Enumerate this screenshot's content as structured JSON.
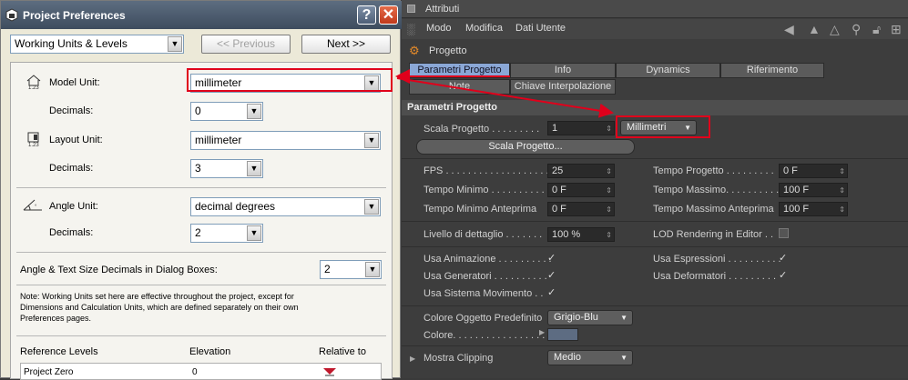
{
  "left": {
    "title": "Project Preferences",
    "help_glyph": "?",
    "close_glyph": "✕",
    "category": "Working Units & Levels",
    "prev_label": "<< Previous",
    "next_label": "Next >>",
    "model_unit_label": "Model Unit:",
    "model_unit_value": "millimeter",
    "model_decimals_label": "Decimals:",
    "model_decimals_value": "0",
    "layout_unit_label": "Layout Unit:",
    "layout_unit_value": "millimeter",
    "layout_decimals_label": "Decimals:",
    "layout_decimals_value": "3",
    "angle_unit_label": "Angle Unit:",
    "angle_unit_value": "decimal degrees",
    "angle_decimals_label": "Decimals:",
    "angle_decimals_value": "2",
    "dialog_decimals_label": "Angle & Text Size Decimals in Dialog Boxes:",
    "dialog_decimals_value": "2",
    "note_line1": "Note: Working Units set here are effective throughout the project, except for",
    "note_line2": "Dimensions and Calculation Units, which are defined separately on their own",
    "note_line3": "Preferences pages.",
    "ref_col1": "Reference Levels",
    "ref_col2": "Elevation",
    "ref_col3": "Relative to",
    "ref_row_name": "Project Zero",
    "ref_row_elev": "0"
  },
  "right": {
    "title": "Attributi",
    "menu": [
      "Modo",
      "Modifica",
      "Dati Utente"
    ],
    "object_name": "Progetto",
    "tabs_row1": [
      "Parametri Progetto",
      "Info",
      "Dynamics",
      "Riferimento"
    ],
    "tabs_row2": [
      "Note",
      "Chiave Interpolazione"
    ],
    "section": "Parametri Progetto",
    "scala_label": "Scala Progetto . . . . . . . . .",
    "scala_value": "1",
    "scala_unit": "Millimetri",
    "scala_button": "Scala Progetto...",
    "fps_label": "FPS . . . . . . . . . . . . . . . . . . . .",
    "fps_value": "25",
    "tempo_progetto_label": "Tempo Progetto . . . . . . . . .",
    "tempo_progetto_value": "0 F",
    "tempo_minimo_label": "Tempo Minimo . . . . . . . . . . .",
    "tempo_minimo_value": "0 F",
    "tempo_massimo_label": "Tempo Massimo. . . . . . . . . .",
    "tempo_massimo_value": "100 F",
    "tmin_anteprima_label": "Tempo Minimo Anteprima",
    "tmin_anteprima_value": "0 F",
    "tmax_anteprima_label": "Tempo Massimo Anteprima",
    "tmax_anteprima_value": "100 F",
    "dettaglio_label": "Livello di dettaglio . . . . . . .",
    "dettaglio_value": "100 %",
    "lod_label": "LOD Rendering in Editor . .",
    "usa_animazione": "Usa Animazione . . . . . . . . . .",
    "usa_espressioni": "Usa Espressioni . . . . . . . . . .",
    "usa_generatori": "Usa Generatori . . . . . . . . . .",
    "usa_deformatori": "Usa Deformatori . . . . . . . . .",
    "usa_movimento": "Usa Sistema Movimento . .",
    "colore_pred_label": "Colore Oggetto Predefinito",
    "colore_pred_value": "Grigio-Blu",
    "colore_label": "Colore. . . . . . . . . . . . . . . . .",
    "clipping_label": "Mostra Clipping",
    "clipping_value": "Medio",
    "check_glyph": "✓"
  },
  "colors": {
    "highlight": "#e0001b",
    "active_tab": "#8aa7d6"
  }
}
